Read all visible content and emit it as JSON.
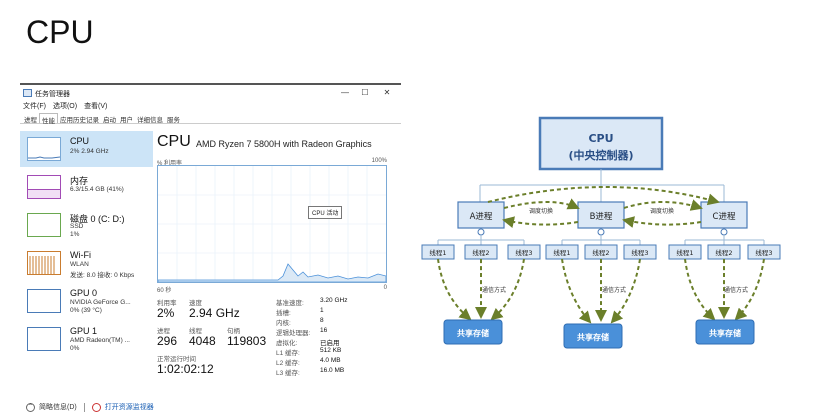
{
  "slide": {
    "title": "CPU"
  },
  "task_manager": {
    "title": "任务管理器",
    "window_controls": {
      "minimize": "—",
      "maximize": "☐",
      "close": "✕"
    },
    "menu": [
      "文件(F)",
      "选项(O)",
      "查看(V)"
    ],
    "tabs": [
      "进程",
      "性能",
      "应用历史记录",
      "启动",
      "用户",
      "详细信息",
      "服务"
    ],
    "active_tab": "性能",
    "sidebar": [
      {
        "name": "CPU",
        "sub1": "2% 2.94 GHz",
        "sub2": "",
        "sub3": ""
      },
      {
        "name": "内存",
        "sub1": "6.3/15.4 GB (41%)",
        "sub2": "",
        "sub3": ""
      },
      {
        "name": "磁盘 0 (C: D:)",
        "sub1": "SSD",
        "sub2": "1%",
        "sub3": ""
      },
      {
        "name": "Wi-Fi",
        "sub1": "WLAN",
        "sub2": "发送: 8.0 接收: 0 Kbps",
        "sub3": ""
      },
      {
        "name": "GPU 0",
        "sub1": "NVIDIA GeForce G...",
        "sub2": "0% (39 °C)",
        "sub3": ""
      },
      {
        "name": "GPU 1",
        "sub1": "AMD Radeon(TM) ...",
        "sub2": "0%",
        "sub3": ""
      }
    ],
    "main": {
      "heading": "CPU",
      "model": "AMD Ryzen 7 5800H with Radeon Graphics",
      "util_label": "% 利用率",
      "util_max": "100%",
      "time_label": "60 秒",
      "zero": "0",
      "tooltip": "CPU 活动",
      "stats": {
        "util_label": "利用率",
        "util_value": "2%",
        "speed_label": "速度",
        "speed_value": "2.94 GHz",
        "proc_label": "进程",
        "proc_value": "296",
        "thread_label": "线程",
        "thread_value": "4048",
        "handle_label": "句柄",
        "handle_value": "119803",
        "uptime_label": "正常运行时间",
        "uptime_value": "1:02:02:12"
      },
      "specs": [
        {
          "label": "基准速度:",
          "value": "3.20 GHz"
        },
        {
          "label": "插槽:",
          "value": "1"
        },
        {
          "label": "内核:",
          "value": "8"
        },
        {
          "label": "逻辑处理器:",
          "value": "16"
        },
        {
          "label": "虚拟化:",
          "value": "已启用"
        },
        {
          "label": "L1 缓存:",
          "value": "512 KB"
        },
        {
          "label": "L2 缓存:",
          "value": "4.0 MB"
        },
        {
          "label": "L3 缓存:",
          "value": "16.0 MB"
        }
      ]
    },
    "footer": {
      "summary": "简略信息(D)",
      "monitor_link": "打开资源监视器"
    }
  },
  "diagram": {
    "controller_line1": "CPU",
    "controller_line2": "(中央控制器)",
    "processes": [
      "A进程",
      "B进程",
      "C进程"
    ],
    "switch_label": "调度切换",
    "threads": [
      "线程1",
      "线程2",
      "线程3"
    ],
    "comm_label": "通信方式",
    "shared": "共享存储",
    "colors": {
      "box_fill": "#dbe8f6",
      "box_stroke": "#4a7bb7",
      "shared_fill": "#4a90d9",
      "arrow": "#6b7f2a"
    }
  }
}
